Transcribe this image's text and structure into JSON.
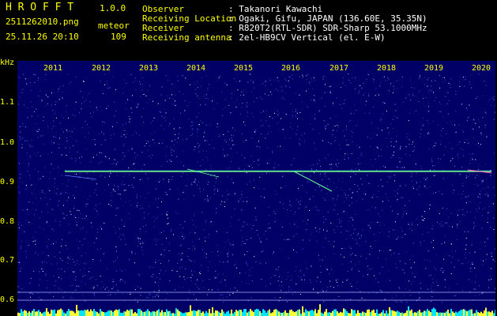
{
  "header": {
    "app_name": "H R O F F T",
    "version": "1.0.0",
    "filename": "2511262010.png",
    "mode_label": "meteor",
    "datetime": "25.11.26 20:10",
    "count": "109",
    "fields": [
      {
        "label": "Observer",
        "value": ": Takanori Kawachi"
      },
      {
        "label": "Receiving Location",
        "value": ": Ogaki, Gifu, JAPAN (136.60E, 35.35N)"
      },
      {
        "label": "Receiver",
        "value": ": R820T2(RTL-SDR) SDR-Sharp 53.1000MHz"
      },
      {
        "label": "Receiving antenna",
        "value": ": 2el-HB9CV Vertical (el. E-W)"
      }
    ]
  },
  "spectrogram": {
    "y_unit": "kHz",
    "y_ticks": [
      "1.1",
      "1.0",
      "0.9",
      "0.8",
      "0.7",
      "0.6"
    ],
    "x_ticks": [
      "2011",
      "2012",
      "2013",
      "2014",
      "2015",
      "2016",
      "2017",
      "2018",
      "2019",
      "2020"
    ],
    "colors": {
      "background": "#000066",
      "noise_light": "#5a6cff",
      "noise_bright": "#ffffff",
      "carrier": "#80ff80",
      "text": "#ffff00",
      "level_bars": "#00e5ff"
    }
  }
}
